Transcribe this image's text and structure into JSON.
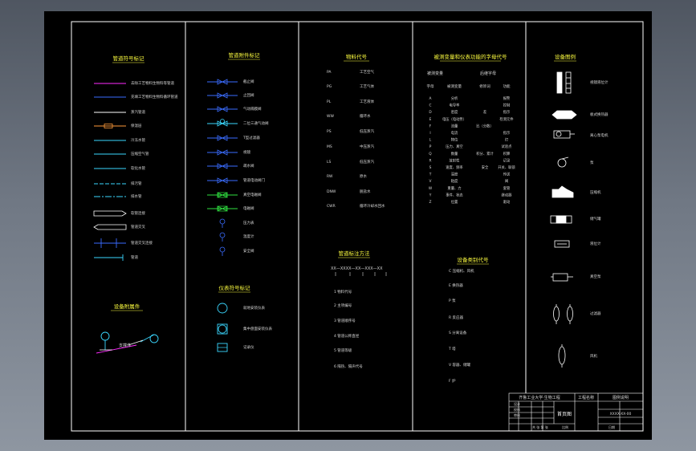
{
  "theme": {
    "paper": "#000000",
    "border": "#ffffff",
    "heading": "#ffff40",
    "text": "#d8d8d8",
    "magenta": "#ff2bff",
    "cyan": "#3ad7ff",
    "blue": "#3a6cff",
    "green": "#30e040",
    "orange": "#ff9a3a",
    "white": "#ffffff"
  },
  "col1": {
    "title": "管道符号标记",
    "items": [
      {
        "label": "去除工艺物料生物料等管道"
      },
      {
        "label": "充填工艺物料生物料循环管道"
      },
      {
        "label": "蒸汽管道"
      },
      {
        "label": "保温层"
      },
      {
        "label": "冷冻水管"
      },
      {
        "label": "压缩空气管"
      },
      {
        "label": "软化水管"
      },
      {
        "label": "排污管"
      },
      {
        "label": "排水管"
      },
      {
        "label": "软管连接"
      },
      {
        "label": "管道交叉"
      },
      {
        "label": "管道交叉连接"
      },
      {
        "label": "管道"
      }
    ],
    "title2": "设备附属件",
    "diagram_label": "支撑件"
  },
  "col2": {
    "title": "管道附件标记",
    "items": [
      {
        "label": "截止阀"
      },
      {
        "label": "止回阀"
      },
      {
        "label": "气动隔膜阀"
      },
      {
        "label": "二位三通气动阀"
      },
      {
        "label": "T型过滤器"
      },
      {
        "label": "视镜"
      },
      {
        "label": "疏水阀"
      },
      {
        "label": "管道电动阀门"
      },
      {
        "label": "真空电磁阀"
      },
      {
        "label": "电磁阀"
      },
      {
        "label": "压力表"
      },
      {
        "label": "温度计"
      },
      {
        "label": "安全阀"
      }
    ],
    "title2": "仪表符号标记",
    "items2": [
      {
        "label": "就地安装仪表"
      },
      {
        "label": "集中盘面安装仪表"
      },
      {
        "label": "记录仪"
      }
    ]
  },
  "col3": {
    "title": "物料代号",
    "items": [
      {
        "code": "PA",
        "label": "工艺空气"
      },
      {
        "code": "PG",
        "label": "工艺气体"
      },
      {
        "code": "PL",
        "label": "工艺液体"
      },
      {
        "code": "WW",
        "label": "循环水"
      },
      {
        "code": "PS",
        "label": "低压蒸汽"
      },
      {
        "code": "MS",
        "label": "中压蒸汽"
      },
      {
        "code": "LS",
        "label": "低压蒸汽"
      },
      {
        "code": "RW",
        "label": "原水"
      },
      {
        "code": "DNW",
        "label": "脱盐水"
      },
      {
        "code": "CWR",
        "label": "循环冷却水回水"
      }
    ],
    "title2": "管道标注方法",
    "formula": "XX—XXXX—XX—XXX—XX",
    "notes": [
      {
        "label": "1 物料代号"
      },
      {
        "label": "2 主项编号"
      },
      {
        "label": "3 管道顺序号"
      },
      {
        "label": "4 管道公称直径"
      },
      {
        "label": "5 管道等级"
      },
      {
        "label": "6 隔热、隔声代号"
      }
    ]
  },
  "col4": {
    "title": "被测变量和仪表功能的字母代号",
    "sub1": "被测变量",
    "sub2": "后继字母",
    "headers": [
      "字母",
      "被测变量",
      "修饰词",
      "功能"
    ],
    "rows": [
      [
        "A",
        "分析",
        "",
        "报警"
      ],
      [
        "C",
        "电导率",
        "",
        "控制"
      ],
      [
        "D",
        "密度",
        "差",
        "指示"
      ],
      [
        "E",
        "电压（电动势）",
        "",
        "检测元件"
      ],
      [
        "F",
        "流量",
        "比（分数）",
        ""
      ],
      [
        "I",
        "电流",
        "",
        "指示"
      ],
      [
        "L",
        "物位",
        "",
        "灯"
      ],
      [
        "P",
        "压力、真空",
        "",
        "试验点"
      ],
      [
        "Q",
        "数量",
        "积分、累计",
        "积算"
      ],
      [
        "R",
        "放射性",
        "",
        "记录"
      ],
      [
        "S",
        "速度、频率",
        "安全",
        "开关、联锁"
      ],
      [
        "T",
        "温度",
        "",
        "传送"
      ],
      [
        "V",
        "粘度",
        "",
        "阀"
      ],
      [
        "W",
        "重量、力",
        "",
        "套管"
      ],
      [
        "Y",
        "事件、状态",
        "",
        "继动器"
      ],
      [
        "Z",
        "位置",
        "",
        "驱动"
      ]
    ],
    "title2": "设备类别代号",
    "cats": [
      {
        "label": "C 压缩机、风机"
      },
      {
        "label": "E 换热器"
      },
      {
        "label": "P 泵"
      },
      {
        "label": "R 反应器"
      },
      {
        "label": "S 分离设备"
      },
      {
        "label": "T 塔"
      },
      {
        "label": "V 容器、储罐"
      },
      {
        "label": "F 炉"
      }
    ]
  },
  "col5": {
    "title": "设备图例",
    "items": [
      {
        "label": "视镜液位计"
      },
      {
        "label": "板式换热器"
      },
      {
        "label": "离心泵电机"
      },
      {
        "label": "泵"
      },
      {
        "label": "压缩机"
      },
      {
        "label": "储气罐"
      },
      {
        "label": "液位计"
      },
      {
        "label": "真空泵"
      },
      {
        "label": "过滤器"
      },
      {
        "label": "风机"
      }
    ]
  },
  "titleblock": {
    "school": "齐鲁工业大学·生物工程",
    "project": "工程名称",
    "drawing": "图例说明",
    "code": "XXXX-XX-00",
    "sheet": "首页图",
    "design": "设计",
    "check": "校核",
    "approve": "审核",
    "scale": "比例",
    "date": "日期",
    "sheets": "共 张 第 张"
  }
}
